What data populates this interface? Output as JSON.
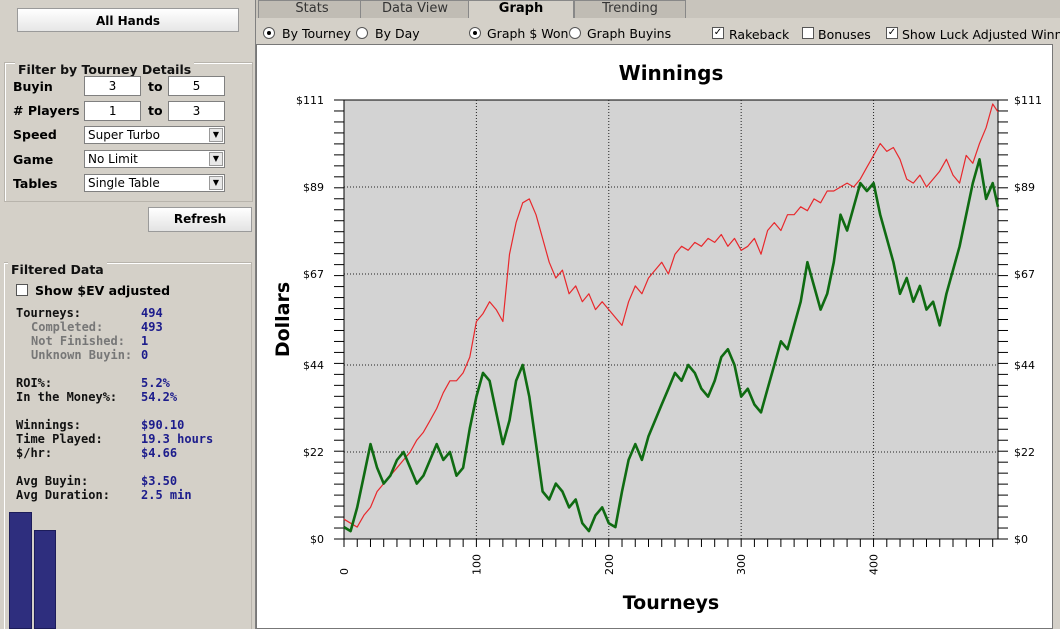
{
  "sidebar": {
    "all_hands_label": "All Hands",
    "filter_title": "Filter by Tourney Details",
    "buyin_label": "Buyin",
    "buyin_from": "3",
    "buyin_to": "5",
    "players_label": "# Players",
    "players_from": "1",
    "players_to": "3",
    "to_label": "to",
    "speed_label": "Speed",
    "speed_value": "Super Turbo",
    "game_label": "Game",
    "game_value": "No Limit",
    "tables_label": "Tables",
    "tables_value": "Single Table",
    "refresh_label": "Refresh",
    "filtered_title": "Filtered Data",
    "show_ev_label": "Show $EV adjusted",
    "show_ev_checked": false,
    "stats": [
      {
        "label": "Tourneys:",
        "value": "494",
        "sub": false
      },
      {
        "label": "Completed:",
        "value": "493",
        "sub": true
      },
      {
        "label": "Not Finished:",
        "value": "1",
        "sub": true
      },
      {
        "label": "Unknown Buyin:",
        "value": "0",
        "sub": true
      },
      {
        "label": "ROI%:",
        "value": "5.2%",
        "sub": false
      },
      {
        "label": "In the Money%:",
        "value": "54.2%",
        "sub": false
      },
      {
        "label": "Winnings:",
        "value": "$90.10",
        "sub": false
      },
      {
        "label": "Time Played:",
        "value": "19.3 hours",
        "sub": false
      },
      {
        "label": "$/hr:",
        "value": "$4.66",
        "sub": false
      },
      {
        "label": "Avg Buyin:",
        "value": "$3.50",
        "sub": false
      },
      {
        "label": "Avg Duration:",
        "value": "2.5 min",
        "sub": false
      }
    ]
  },
  "tabs": [
    "Stats",
    "Data View",
    "Graph",
    "Trending"
  ],
  "active_tab": "Graph",
  "options": {
    "by_tourney": "By Tourney",
    "by_day": "By Day",
    "graph_won": "Graph $ Won",
    "graph_buyins": "Graph Buyins",
    "rakeback": "Rakeback",
    "rakeback_checked": true,
    "bonuses": "Bonuses",
    "bonuses_checked": false,
    "luck_adjusted": "Show Luck Adjusted Winnings",
    "luck_checked": true
  },
  "colors": {
    "luck_line": "#e8282c",
    "winnings_line": "#0f6b12",
    "plot_bg": "#d3d3d3"
  },
  "chart_data": {
    "type": "line",
    "title": "Winnings",
    "xlabel": "Tourneys",
    "ylabel": "Dollars",
    "xlim": [
      0,
      494
    ],
    "ylim": [
      0,
      111
    ],
    "x_ticks": [
      0,
      100,
      200,
      300,
      400
    ],
    "y_ticks": [
      0,
      22,
      44,
      67,
      89,
      111
    ],
    "y_tick_labels": [
      "$0",
      "$22",
      "$44",
      "$67",
      "$89",
      "$111"
    ],
    "grid": true,
    "series": [
      {
        "color": "#e8282c",
        "x": [
          0,
          5,
          10,
          15,
          20,
          25,
          30,
          35,
          40,
          45,
          50,
          55,
          60,
          65,
          70,
          75,
          80,
          85,
          90,
          95,
          100,
          105,
          110,
          115,
          120,
          125,
          130,
          135,
          140,
          145,
          150,
          155,
          160,
          165,
          170,
          175,
          180,
          185,
          190,
          195,
          200,
          205,
          210,
          215,
          220,
          225,
          230,
          235,
          240,
          245,
          250,
          255,
          260,
          265,
          270,
          275,
          280,
          285,
          290,
          295,
          300,
          305,
          310,
          315,
          320,
          325,
          330,
          335,
          340,
          345,
          350,
          355,
          360,
          365,
          370,
          375,
          380,
          385,
          390,
          395,
          400,
          405,
          410,
          415,
          420,
          425,
          430,
          435,
          440,
          445,
          450,
          455,
          460,
          465,
          470,
          475,
          480,
          485,
          490,
          494
        ],
        "y": [
          5,
          4,
          3,
          6,
          8,
          12,
          14,
          16,
          18,
          20,
          22,
          25,
          27,
          30,
          33,
          37,
          40,
          40,
          42,
          46,
          55,
          57,
          60,
          58,
          55,
          72,
          80,
          85,
          86,
          82,
          76,
          70,
          66,
          68,
          62,
          64,
          60,
          62,
          58,
          60,
          58,
          56,
          54,
          60,
          64,
          62,
          66,
          68,
          70,
          67,
          72,
          74,
          73,
          75,
          74,
          76,
          75,
          77,
          74,
          76,
          73,
          74,
          76,
          72,
          78,
          80,
          78,
          82,
          82,
          84,
          83,
          86,
          85,
          88,
          88,
          89,
          90,
          89,
          91,
          94,
          97,
          100,
          98,
          99,
          96,
          91,
          90,
          92,
          89,
          91,
          93,
          96,
          92,
          90,
          97,
          95,
          100,
          104,
          110,
          108
        ]
      },
      {
        "color": "#0f6b12",
        "x": [
          0,
          5,
          10,
          15,
          20,
          25,
          30,
          35,
          40,
          45,
          50,
          55,
          60,
          65,
          70,
          75,
          80,
          85,
          90,
          95,
          100,
          105,
          110,
          115,
          120,
          125,
          130,
          135,
          140,
          145,
          150,
          155,
          160,
          165,
          170,
          175,
          180,
          185,
          190,
          195,
          200,
          205,
          210,
          215,
          220,
          225,
          230,
          235,
          240,
          245,
          250,
          255,
          260,
          265,
          270,
          275,
          280,
          285,
          290,
          295,
          300,
          305,
          310,
          315,
          320,
          325,
          330,
          335,
          340,
          345,
          350,
          355,
          360,
          365,
          370,
          375,
          380,
          385,
          390,
          395,
          400,
          405,
          410,
          415,
          420,
          425,
          430,
          435,
          440,
          445,
          450,
          455,
          460,
          465,
          470,
          475,
          480,
          485,
          490,
          494
        ],
        "y": [
          3,
          2,
          8,
          16,
          24,
          18,
          14,
          16,
          20,
          22,
          18,
          14,
          16,
          20,
          24,
          20,
          22,
          16,
          18,
          28,
          36,
          42,
          40,
          32,
          24,
          30,
          40,
          44,
          36,
          24,
          12,
          10,
          14,
          12,
          8,
          10,
          4,
          2,
          6,
          8,
          4,
          3,
          12,
          20,
          24,
          20,
          26,
          30,
          34,
          38,
          42,
          40,
          44,
          42,
          38,
          36,
          40,
          46,
          48,
          44,
          36,
          38,
          34,
          32,
          38,
          44,
          50,
          48,
          54,
          60,
          70,
          64,
          58,
          62,
          70,
          82,
          78,
          84,
          90,
          88,
          90,
          82,
          76,
          70,
          62,
          66,
          60,
          64,
          58,
          60,
          54,
          62,
          68,
          74,
          82,
          90,
          96,
          86,
          90,
          84
        ]
      }
    ]
  }
}
